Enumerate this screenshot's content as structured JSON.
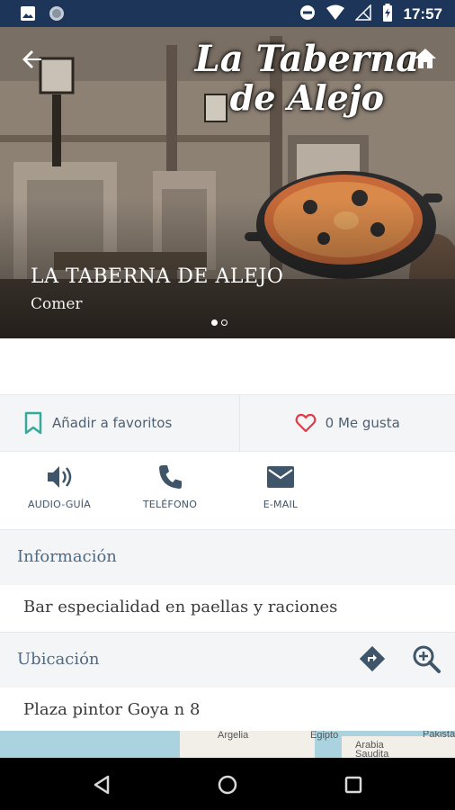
{
  "status_bar": {
    "time": "17:57",
    "icons": [
      "image-icon",
      "circle-icon",
      "dnd-icon",
      "wifi-icon",
      "no-signal-icon",
      "battery-icon"
    ]
  },
  "hero": {
    "logo_line1": "La Taberna",
    "logo_line2": "de Alejo",
    "title": "LA TABERNA DE ALEJO",
    "subtitle": "Comer",
    "slides_total": 2,
    "slide_active": 1
  },
  "actions": {
    "favorites_label": "Añadir a favoritos",
    "likes_label": "0 Me gusta"
  },
  "contact": {
    "audio_label": "AUDIO-GUÍA",
    "phone_label": "TELÉFONO",
    "email_label": "E-MAIL"
  },
  "info": {
    "title": "Información",
    "text": "Bar especialidad en paellas y raciones"
  },
  "location": {
    "title": "Ubicación",
    "address": "Plaza pintor Goya n 8"
  },
  "map": {
    "labels": [
      "Argelia",
      "Egipto",
      "Arabia",
      "Saudita",
      "Pakistá"
    ]
  },
  "colors": {
    "status_bar": "#1d3558",
    "accent": "#3f5569",
    "heart": "#e53946",
    "bookmark": "#37a99a",
    "section_title": "#4e6a86"
  }
}
